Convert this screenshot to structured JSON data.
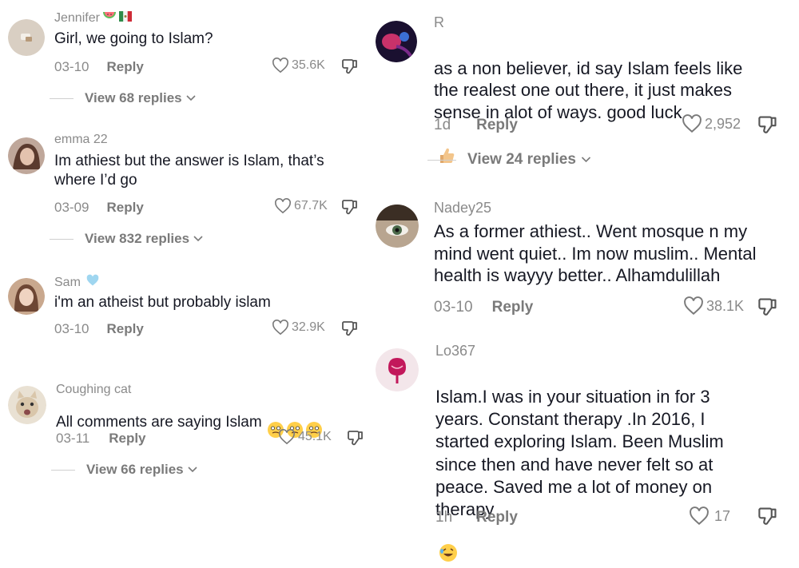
{
  "left": [
    {
      "name": "Jennifer",
      "name_emojis": [
        "watermelon-icon",
        "mexico-flag-icon"
      ],
      "text": "Girl, we going to Islam?",
      "date": "03-10",
      "reply": "Reply",
      "likes": "35.6K",
      "view_replies": "View 68 replies",
      "avatar_color": "#c9b9a6"
    },
    {
      "name": "emma 22",
      "text": "Im athiest but the answer is Islam, that’s\nwhere I’d go",
      "date": "03-09",
      "reply": "Reply",
      "likes": "67.7K",
      "view_replies": "View 832 replies",
      "avatar_color": "#6b4a3f"
    },
    {
      "name": "Sam",
      "name_emojis": [
        "light-blue-heart-icon"
      ],
      "text": "i'm an atheist but probably islam",
      "date": "03-10",
      "reply": "Reply",
      "likes": "32.9K",
      "avatar_color": "#8a6a55"
    },
    {
      "name": "Coughing cat",
      "text": "All comments are saying Islam",
      "text_emojis": [
        "teary-face-icon",
        "teary-face-icon",
        "teary-face-icon"
      ],
      "date": "03-11",
      "reply": "Reply",
      "likes": "45.1K",
      "view_replies": "View 66 replies",
      "avatar_color": "#d8cbb8"
    }
  ],
  "right": [
    {
      "name": "R",
      "text": "as a non believer, id say Islam feels like\nthe realest one out there, it just makes\nsense in alot of ways. good luck",
      "text_emojis": [
        "thumbs-up-icon"
      ],
      "date": "1d",
      "reply": "Reply",
      "likes": "2,952",
      "view_replies": "View 24 replies",
      "avatar_color": "#1a1030"
    },
    {
      "name": "Nadey25",
      "text": "As a former athiest.. Went mosque n my\nmind went quiet.. Im now muslim.. Mental\nhealth is wayyy better.. Alhamdulillah",
      "date": "03-10",
      "reply": "Reply",
      "likes": "38.1K",
      "avatar_color": "#5b4c3c"
    },
    {
      "name": "Lo367",
      "text": "Islam.I was in your situation in for 3\nyears. Constant therapy .In 2016, I\nstarted exploring Islam. Been Muslim\nsince then and have never felt so at\npeace. Saved me a lot of money on\ntherapy",
      "text_emojis": [
        "rolling-laughing-icon"
      ],
      "date": "1h",
      "reply": "Reply",
      "likes": "17",
      "avatar_color": "#f0e4e8"
    }
  ]
}
